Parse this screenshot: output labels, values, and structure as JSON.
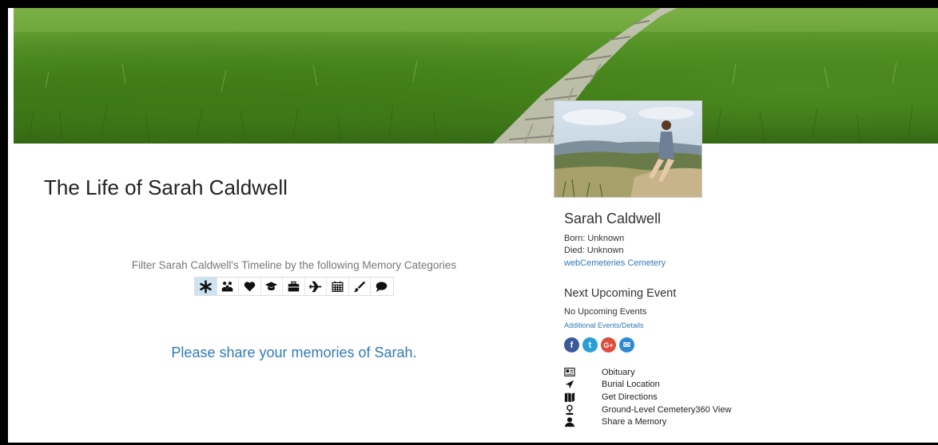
{
  "page": {
    "title": "The Life of Sarah Caldwell"
  },
  "filter": {
    "label": "Filter Sarah Caldwell's Timeline by the following Memory Categories",
    "categories": [
      {
        "icon": "asterisk-icon",
        "active": true
      },
      {
        "icon": "family-icon",
        "active": false
      },
      {
        "icon": "heart-icon",
        "active": false
      },
      {
        "icon": "graduation-cap-icon",
        "active": false
      },
      {
        "icon": "briefcase-icon",
        "active": false
      },
      {
        "icon": "airplane-icon",
        "active": false
      },
      {
        "icon": "calendar-icon",
        "active": false
      },
      {
        "icon": "paintbrush-icon",
        "active": false
      },
      {
        "icon": "speech-bubble-icon",
        "active": false
      }
    ]
  },
  "share": {
    "label": "Please share your memories of Sarah."
  },
  "profile": {
    "name": "Sarah Caldwell",
    "born": "Born: Unknown",
    "died": "Died: Unknown",
    "cemetery": "webCemeteries Cemetery"
  },
  "events": {
    "title": "Next Upcoming Event",
    "none": "No Upcoming Events",
    "details_link": "Additional Events/Details"
  },
  "social": [
    {
      "icon": "facebook-icon",
      "glyph": "f",
      "color": "#3b5998"
    },
    {
      "icon": "twitter-icon",
      "glyph": "t",
      "color": "#2a9fd6"
    },
    {
      "icon": "google-plus-icon",
      "glyph": "G+",
      "color": "#dd4b39"
    },
    {
      "icon": "email-icon",
      "glyph": "✉",
      "color": "#2d89d5"
    }
  ],
  "links": [
    {
      "icon": "newspaper-icon",
      "label": "Obituary"
    },
    {
      "icon": "location-arrow-icon",
      "label": "Burial Location"
    },
    {
      "icon": "map-icon",
      "label": "Get Directions"
    },
    {
      "icon": "map-pin-icon",
      "label": "Ground-Level Cemetery360 View"
    },
    {
      "icon": "user-icon",
      "label": "Share a Memory"
    }
  ]
}
